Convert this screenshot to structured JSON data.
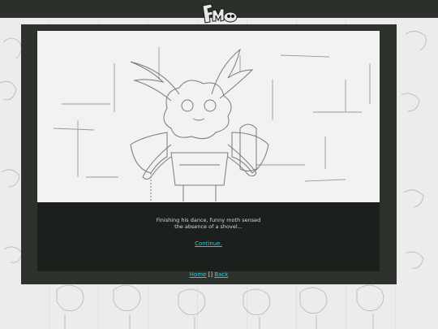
{
  "scene": {
    "caption": "Finishing his dance, funny moth sensed\nthe absence of a shovel...",
    "continue_label": "Continue."
  },
  "nav": {
    "home_label": "Home",
    "separator": "[]",
    "back_label": "Back"
  },
  "colors": {
    "top_bar": "#2b302b",
    "frame": "#2d322c",
    "text_panel": "#1c201c",
    "link": "#33c3d6",
    "background": "#ececec"
  },
  "icons": {
    "site_logo": "mspa-style-logo"
  }
}
